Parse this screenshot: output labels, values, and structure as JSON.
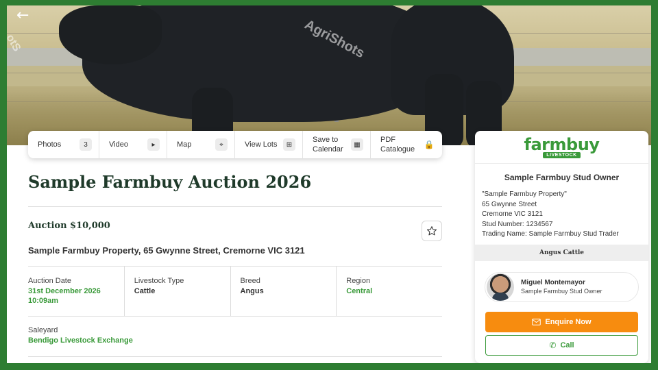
{
  "hero": {
    "watermark": "AgriShots",
    "watermark_left": "otS",
    "icons": {
      "back": "arrow-left-icon"
    }
  },
  "toolbar": [
    {
      "label": "Photos",
      "badge": "3",
      "icon": "photos-count"
    },
    {
      "label": "Video",
      "badge": "▸",
      "icon": "play-icon"
    },
    {
      "label": "Map",
      "badge": "⌖",
      "icon": "map-pin-icon"
    },
    {
      "label": "View Lots",
      "badge": "⊞",
      "icon": "lots-icon"
    },
    {
      "label": "Save to\nCalendar",
      "badge": "▦",
      "icon": "calendar-icon"
    },
    {
      "label": "PDF\nCatalogue",
      "badge": "🔒",
      "icon": "lock-icon"
    }
  ],
  "listing": {
    "title": "Sample Farmbuy Auction 2026",
    "price": "Auction $10,000",
    "address": "Sample Farmbuy Property, 65 Gwynne Street, Cremorne VIC 3121",
    "details": [
      {
        "label": "Auction Date",
        "value": "31st December 2026\n10:09am",
        "color": "green"
      },
      {
        "label": "Livestock Type",
        "value": "Cattle",
        "color": "dark"
      },
      {
        "label": "Breed",
        "value": "Angus",
        "color": "dark"
      },
      {
        "label": "Region",
        "value": "Central",
        "color": "green"
      }
    ],
    "saleyard": {
      "label": "Saleyard",
      "value": "Bendigo Livestock Exchange"
    }
  },
  "panel": {
    "logo": "farmbuy",
    "logo_sub": "LIVESTOCK",
    "owner_title": "Sample Farmbuy Stud Owner",
    "owner_lines": [
      "\"Sample Farmbuy Property\"",
      "65 Gwynne Street",
      "Cremorne VIC 3121",
      "Stud Number: 1234567",
      "Trading Name: Sample Farmbuy Stud Trader"
    ],
    "breed_bar": "Angus Cattle",
    "agent_name": "Miguel Montemayor",
    "agent_role": "Sample Farmbuy Stud Owner",
    "enquire_label": "Enquire Now",
    "call_label": "Call"
  },
  "colors": {
    "frame": "#2e7d32",
    "brand_green": "#3a9a3a",
    "title_green": "#1f3a2a",
    "enquire_orange": "#f78c0f"
  }
}
